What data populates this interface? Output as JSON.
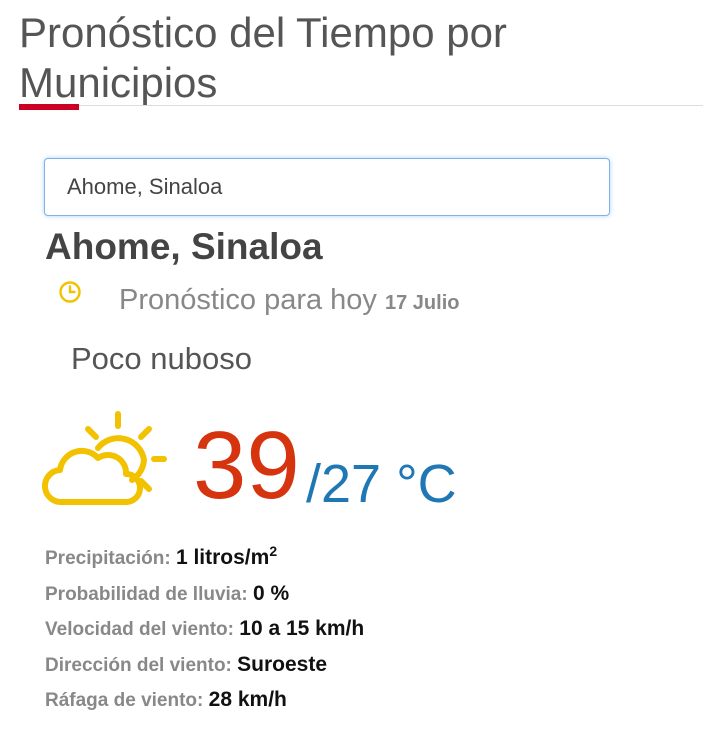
{
  "header": {
    "title": "Pronóstico del Tiempo por Municipios"
  },
  "search": {
    "value": "Ahome, Sinaloa"
  },
  "location": {
    "name": "Ahome, Sinaloa"
  },
  "forecast": {
    "label": "Pronóstico para hoy",
    "date": "17 Julio",
    "condition": "Poco nuboso",
    "temp_max": "39",
    "temp_min": "/27 °C",
    "icon": "partly-cloudy-icon"
  },
  "details": {
    "precip_label": "Precipitación:",
    "precip_value": "1 litros/m",
    "precip_sup": "2",
    "rain_prob_label": "Probabilidad de lluvia:",
    "rain_prob_value": "0 %",
    "wind_speed_label": "Velocidad del viento:",
    "wind_speed_value": "10 a 15 km/h",
    "wind_dir_label": "Dirección del viento:",
    "wind_dir_value": "Suroeste",
    "gust_label": "Ráfaga de viento:",
    "gust_value": "28 km/h"
  },
  "colors": {
    "accent_red": "#cc0022",
    "temp_max": "#d6330f",
    "temp_min": "#1f78b4",
    "icon_yellow": "#f2c200"
  }
}
